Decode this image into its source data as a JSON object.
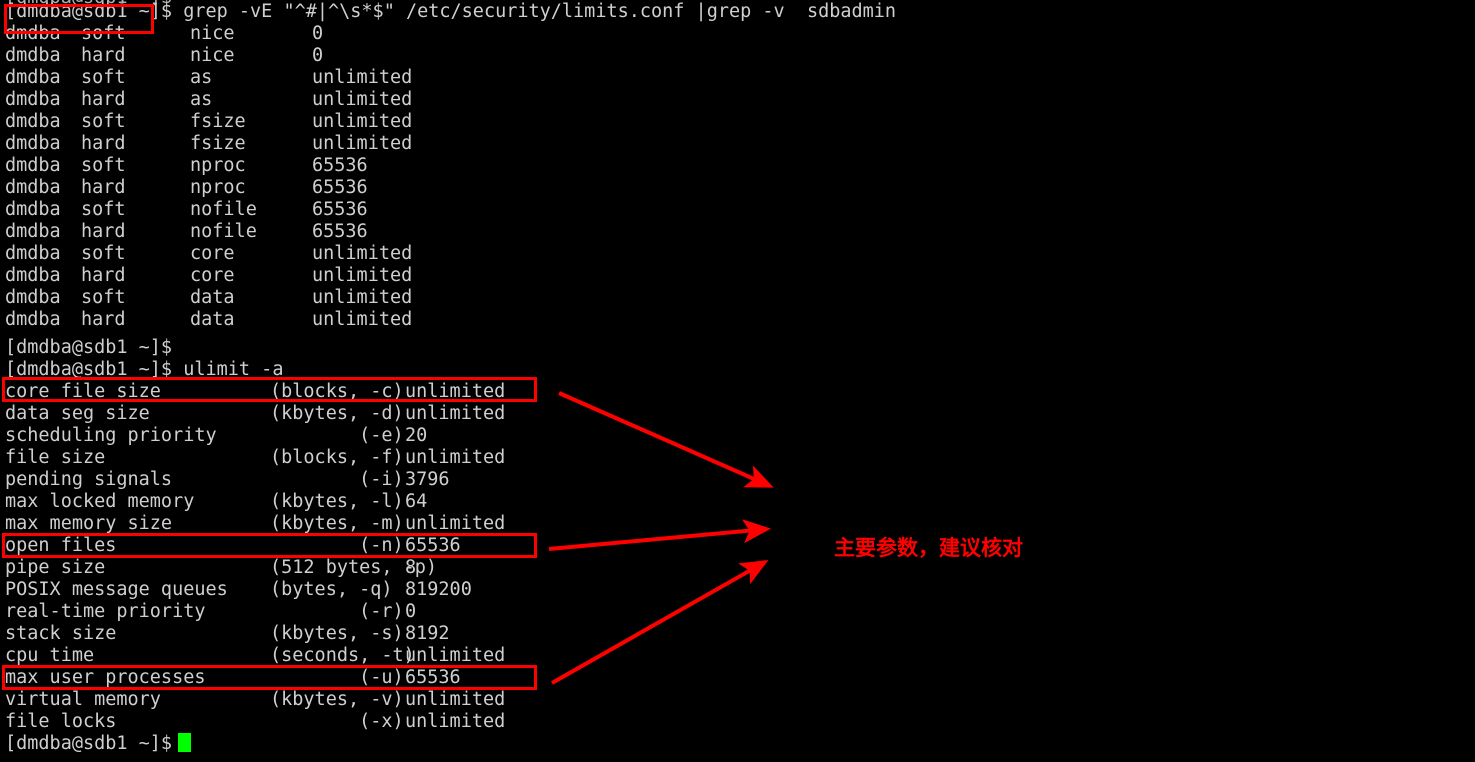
{
  "terminal": {
    "prompt": "[dmdba@sdb1 ~]$",
    "background_color": "#000000",
    "text_color": "#cfcfcf",
    "cursor_color": "#00ff00",
    "annotation_color": "#ff0000",
    "clipped_top_line": "[dmdba@sdb1 ~]$",
    "command_1": "[dmdba@sdb1 ~]$ grep -vE \"^#|^\\s*$\" /etc/security/limits.conf |grep -v  sdbadmin",
    "command_1_parts": {
      "prompt": "[dmdba@sdb1 ~]$",
      "command": " grep -vE \"^#|^\\s*$\" /etc/security/limits.conf |grep -v  sdbadmin"
    },
    "limits_rows": [
      {
        "user": "dmdba",
        "type": "soft",
        "item": "nice",
        "value": "0"
      },
      {
        "user": "dmdba",
        "type": "hard",
        "item": "nice",
        "value": "0"
      },
      {
        "user": "dmdba",
        "type": "soft",
        "item": "as",
        "value": "unlimited"
      },
      {
        "user": "dmdba",
        "type": "hard",
        "item": "as",
        "value": "unlimited"
      },
      {
        "user": "dmdba",
        "type": "soft",
        "item": "fsize",
        "value": "unlimited"
      },
      {
        "user": "dmdba",
        "type": "hard",
        "item": "fsize",
        "value": "unlimited"
      },
      {
        "user": "dmdba",
        "type": "soft",
        "item": "nproc",
        "value": "65536"
      },
      {
        "user": "dmdba",
        "type": "hard",
        "item": "nproc",
        "value": "65536"
      },
      {
        "user": "dmdba",
        "type": "soft",
        "item": "nofile",
        "value": "65536"
      },
      {
        "user": "dmdba",
        "type": "hard",
        "item": "nofile",
        "value": "65536"
      },
      {
        "user": "dmdba",
        "type": "soft",
        "item": "core",
        "value": "unlimited"
      },
      {
        "user": "dmdba",
        "type": "hard",
        "item": "core",
        "value": "unlimited"
      },
      {
        "user": "dmdba",
        "type": "soft",
        "item": "data",
        "value": "unlimited"
      },
      {
        "user": "dmdba",
        "type": "hard",
        "item": "data",
        "value": "unlimited"
      }
    ],
    "idle_prompt_line": "[dmdba@sdb1 ~]$",
    "command_2_parts": {
      "prompt": "[dmdba@sdb1 ~]$",
      "command": " ulimit -a"
    },
    "ulimit_rows": [
      {
        "label": "core file size",
        "unit": "(blocks, -c)",
        "value": "unlimited"
      },
      {
        "label": "data seg size",
        "unit": "(kbytes, -d)",
        "value": "unlimited"
      },
      {
        "label": "scheduling priority",
        "unit": "        (-e)",
        "value": "20"
      },
      {
        "label": "file size",
        "unit": "(blocks, -f)",
        "value": "unlimited"
      },
      {
        "label": "pending signals",
        "unit": "        (-i)",
        "value": "3796"
      },
      {
        "label": "max locked memory",
        "unit": "(kbytes, -l)",
        "value": "64"
      },
      {
        "label": "max memory size",
        "unit": "(kbytes, -m)",
        "value": "unlimited"
      },
      {
        "label": "open files",
        "unit": "        (-n)",
        "value": "65536"
      },
      {
        "label": "pipe size",
        "unit": "(512 bytes, -p)",
        "value": "8"
      },
      {
        "label": "POSIX message queues",
        "unit": "(bytes, -q)",
        "value": "819200"
      },
      {
        "label": "real-time priority",
        "unit": "        (-r)",
        "value": "0"
      },
      {
        "label": "stack size",
        "unit": "(kbytes, -s)",
        "value": "8192"
      },
      {
        "label": "cpu time",
        "unit": "(seconds, -t)",
        "value": "unlimited"
      },
      {
        "label": "max user processes",
        "unit": "        (-u)",
        "value": "65536"
      },
      {
        "label": "virtual memory",
        "unit": "(kbytes, -v)",
        "value": "unlimited"
      },
      {
        "label": "file locks",
        "unit": "        (-x)",
        "value": "unlimited"
      }
    ],
    "final_prompt": "[dmdba@sdb1 ~]$"
  },
  "annotation": {
    "note_text": "主要参数，建议核对",
    "highlight_labels": [
      "prompt-highlight",
      "core-file-size-highlight",
      "open-files-highlight",
      "max-user-processes-highlight"
    ]
  }
}
